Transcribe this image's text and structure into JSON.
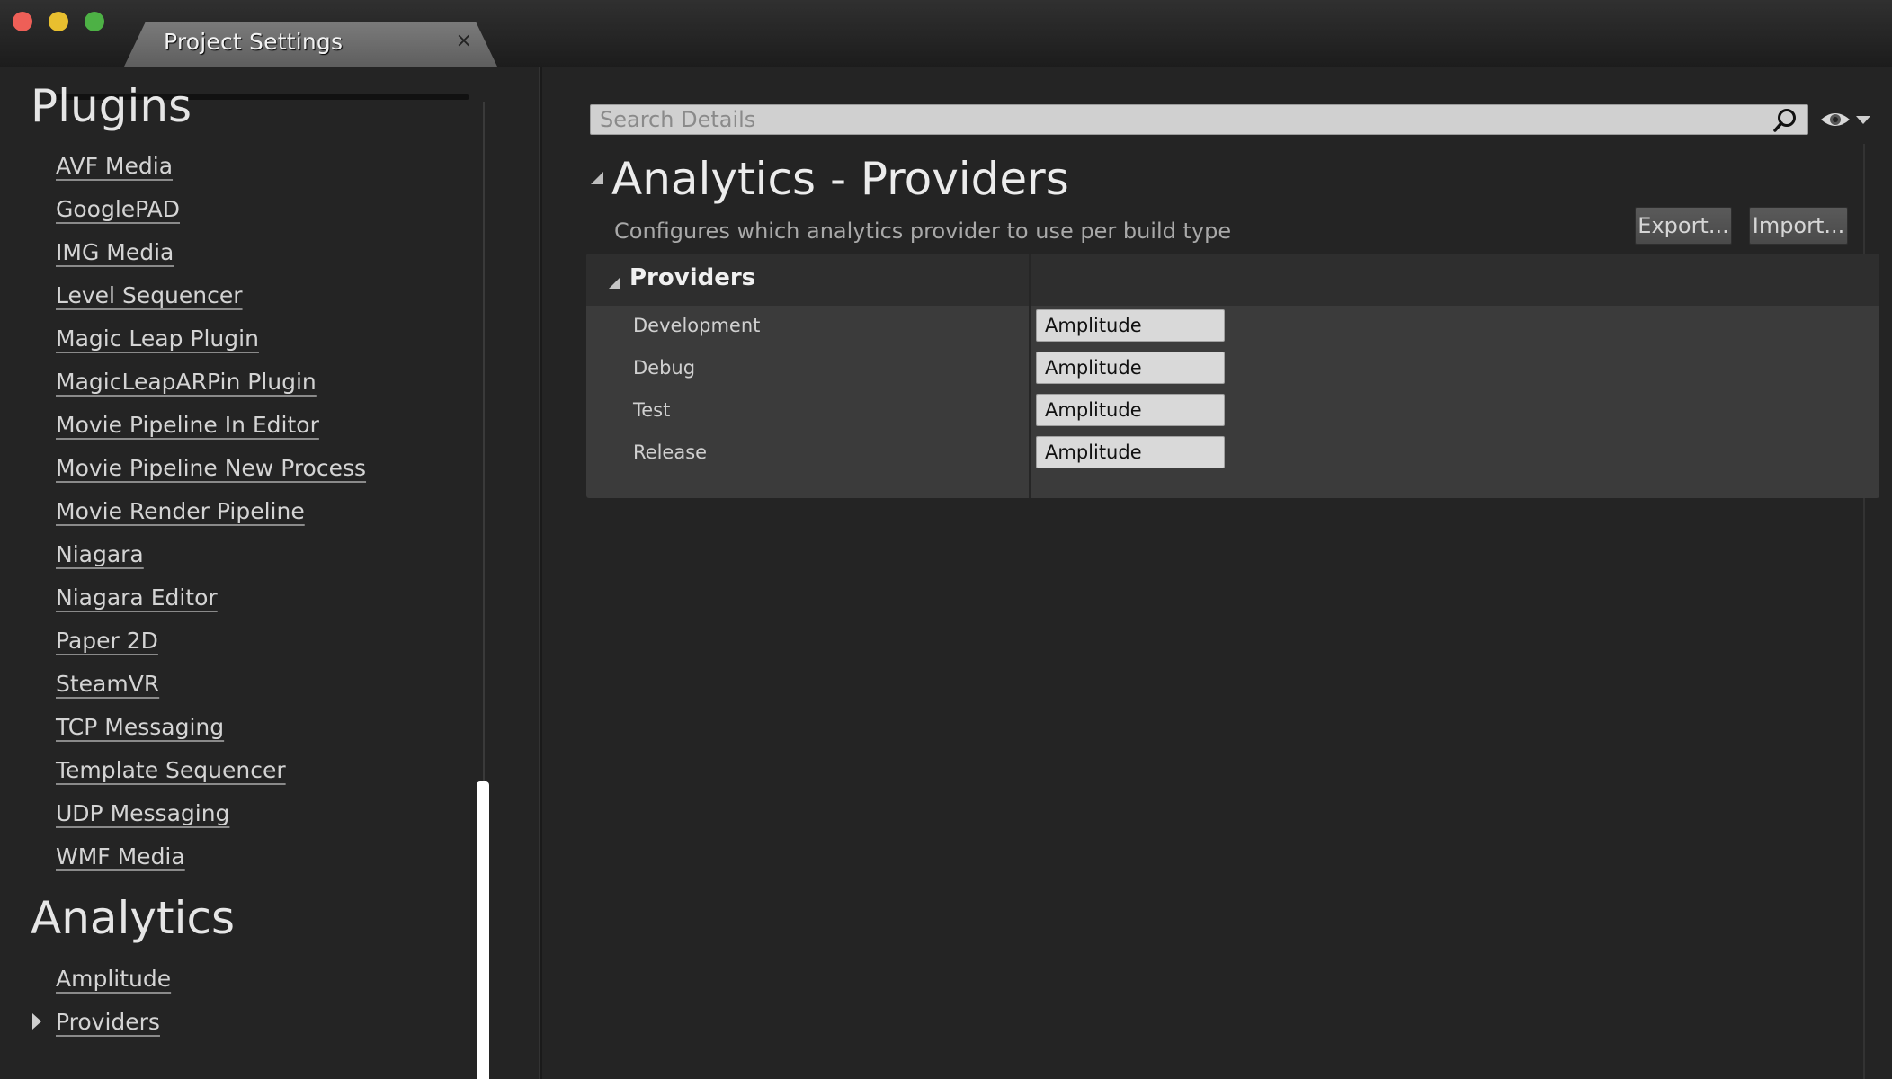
{
  "window": {
    "tab_title": "Project Settings",
    "tab_close_glyph": "×"
  },
  "sidebar": {
    "plugins_heading": "Plugins",
    "plugin_items": [
      "AVF Media",
      "GooglePAD",
      "IMG Media",
      "Level Sequencer",
      "Magic Leap Plugin",
      "MagicLeapARPin Plugin",
      "Movie Pipeline In Editor",
      "Movie Pipeline New Process",
      "Movie Render Pipeline",
      "Niagara",
      "Niagara Editor",
      "Paper 2D",
      "SteamVR",
      "TCP Messaging",
      "Template Sequencer",
      "UDP Messaging",
      "WMF Media"
    ],
    "analytics_heading": "Analytics",
    "analytics_items": [
      "Amplitude",
      "Providers"
    ],
    "selected_item": "Providers"
  },
  "search": {
    "placeholder": "Search Details"
  },
  "section": {
    "title": "Analytics - Providers",
    "description": "Configures which analytics provider to use per build type",
    "export_label": "Export...",
    "import_label": "Import..."
  },
  "category": {
    "title": "Providers",
    "properties": [
      {
        "label": "Development",
        "value": "Amplitude"
      },
      {
        "label": "Debug",
        "value": "Amplitude"
      },
      {
        "label": "Test",
        "value": "Amplitude"
      },
      {
        "label": "Release",
        "value": "Amplitude"
      }
    ]
  },
  "colors": {
    "background": "#242424",
    "panel": "#3b3b3b",
    "close": "#ee5f57",
    "minimize": "#e8bf2f",
    "maximize": "#4db145"
  },
  "icons": [
    "close-traffic-light",
    "minimize-traffic-light",
    "maximize-traffic-light",
    "search-icon",
    "eye-icon",
    "chevron-down-icon",
    "expand-arrow-icon",
    "collapse-arrow-icon"
  ]
}
